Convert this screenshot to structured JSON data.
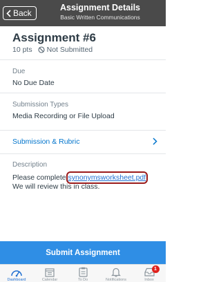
{
  "nav": {
    "back_label": "Back",
    "title": "Assignment Details",
    "subtitle": "Basic Written Communications"
  },
  "assignment": {
    "title": "Assignment #6",
    "points": "10 pts",
    "status": "Not Submitted"
  },
  "due": {
    "label": "Due",
    "value": "No Due Date"
  },
  "submission_types": {
    "label": "Submission Types",
    "value": "Media Recording or File Upload"
  },
  "rubric": {
    "label": "Submission & Rubric"
  },
  "description": {
    "label": "Description",
    "before_link": "Please complete ",
    "link_text": "synonymsworksheet.pdf",
    "after_link": ". We will review this in class."
  },
  "submit_label": "Submit Assignment",
  "tabs": [
    {
      "label": "Dashboard",
      "icon": "dashboard-icon",
      "active": true
    },
    {
      "label": "Calendar",
      "icon": "calendar-icon",
      "active": false
    },
    {
      "label": "To Do",
      "icon": "todo-icon",
      "active": false
    },
    {
      "label": "Notifications",
      "icon": "bell-icon",
      "active": false
    },
    {
      "label": "Inbox",
      "icon": "inbox-icon",
      "active": false,
      "badge": "1"
    }
  ],
  "colors": {
    "nav_bar": "#4a4a4a",
    "accent": "#2f8ee5",
    "link": "#0074cc",
    "highlight_outline": "#9a1a1a",
    "badge": "#e0211c"
  }
}
